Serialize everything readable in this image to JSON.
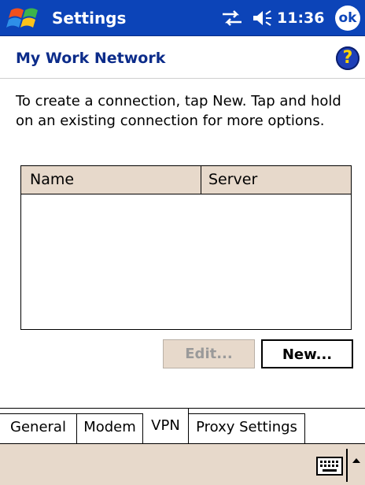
{
  "titlebar": {
    "app_title": "Settings",
    "clock": "11:36",
    "ok_label": "ok",
    "start_icon": "windows-flag-icon",
    "connectivity_icon": "connectivity-arrows-icon",
    "volume_icon": "speaker-volume-icon",
    "color": "#0c44b8"
  },
  "header": {
    "title": "My Work Network",
    "help_label": "?"
  },
  "instructions": "To create a connection, tap New. Tap and hold on an existing connection for more options.",
  "list": {
    "columns": [
      "Name",
      "Server"
    ],
    "rows": []
  },
  "buttons": {
    "edit": "Edit...",
    "new": "New..."
  },
  "tabs": [
    {
      "label": "General"
    },
    {
      "label": "Modem"
    },
    {
      "label": "VPN",
      "active": true
    },
    {
      "label": "Proxy Settings"
    }
  ],
  "menubar": {
    "keyboard_icon": "keyboard-icon",
    "sip_arrow_icon": "up-arrow-icon",
    "color": "#e7d9cb"
  }
}
